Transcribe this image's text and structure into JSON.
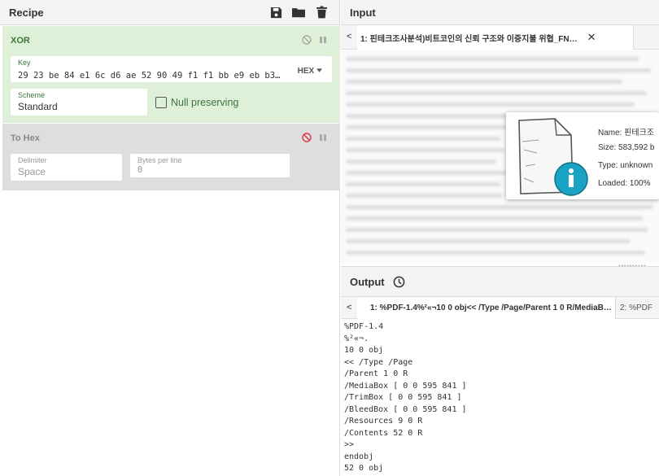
{
  "recipe": {
    "title": "Recipe",
    "operations": [
      {
        "name": "XOR",
        "key_label": "Key",
        "key_value": "29 23 be 84 e1 6c d6 ae 52 90 49 f1 f1 bb e9 eb b3…",
        "key_format": "HEX",
        "scheme_label": "Scheme",
        "scheme_value": "Standard",
        "null_preserving_label": "Null preserving"
      },
      {
        "name": "To Hex",
        "delimiter_label": "Delimiter",
        "delimiter_value": "Space",
        "bytes_per_line_label": "Bytes per line",
        "bytes_per_line_value": "0"
      }
    ]
  },
  "input": {
    "title": "Input",
    "tab_label": "1: 핀테크조사분석)비트코인의 신뢰 구조와 이중지불 위협_FN…",
    "file": {
      "name": "Name: 핀테크조",
      "size": "Size: 583,592 b",
      "type": "Type: unknown",
      "loaded": "Loaded: 100%"
    }
  },
  "output": {
    "title": "Output",
    "tabs": [
      "1: %PDF-1.4%²«¬10 0 obj<< /Type /Page/Parent 1 0 R/MediaB…",
      "2: %PDF"
    ],
    "lines": [
      "%PDF-1.4",
      "%²«¬.",
      "10 0 obj",
      "<< /Type /Page",
      "/Parent 1 0 R",
      "/MediaBox [ 0 0 595 841 ]",
      "/TrimBox [ 0 0 595 841 ]",
      "/BleedBox [ 0 0 595 841 ]",
      "/Resources 9 0 R",
      "/Contents 52 0 R",
      ">>",
      "endobj",
      "52 0 obj"
    ]
  },
  "colors": {
    "accent_green": "#3c763d",
    "op_enabled_bg": "#dff0d8",
    "op_disabled_bg": "#dedede",
    "disabled_icon": "#e0344b",
    "info_teal": "#1ba3c6"
  },
  "icons": [
    "save-icon",
    "folder-icon",
    "trash-icon",
    "disable-icon",
    "pause-icon",
    "clock-icon",
    "file-info-icon"
  ]
}
